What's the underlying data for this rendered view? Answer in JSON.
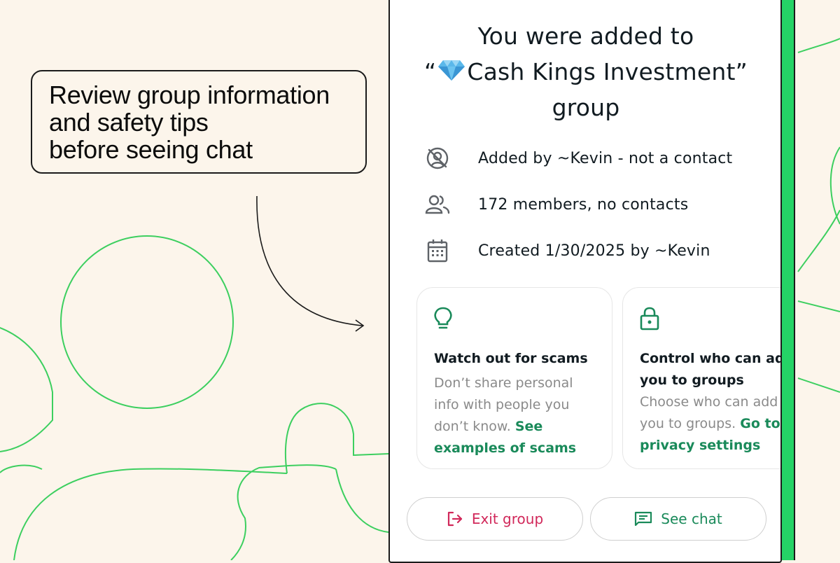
{
  "callout": {
    "lines": [
      "Review group information",
      "and safety tips",
      "before seeing chat"
    ]
  },
  "dialog": {
    "title_line1": "You were added to",
    "title_line2_open": "“",
    "title_emoji": "diamond-emoji",
    "title_line2_name": "Cash Kings Investment”",
    "title_line3": "group",
    "info": [
      {
        "icon": "no-contact-icon",
        "text": "Added by ~Kevin - not a contact"
      },
      {
        "icon": "members-icon",
        "text": "172 members, no contacts"
      },
      {
        "icon": "calendar-icon",
        "text": "Created 1/30/2025 by ~Kevin"
      }
    ],
    "cards": [
      {
        "icon": "lightbulb-icon",
        "title_lines": [
          "Watch out for scams"
        ],
        "body_lines": [
          "Don’t share personal",
          "info with people you"
        ],
        "body_last": "don’t know. ",
        "link_first": "See",
        "link_lines": [
          "examples of scams"
        ]
      },
      {
        "icon": "lock-icon",
        "title_lines": [
          "Control who can add",
          "you to groups"
        ],
        "body_lines": [
          "Choose who can add"
        ],
        "body_last": "you to groups. ",
        "link_first": "Go to",
        "link_lines": [
          "privacy settings"
        ]
      }
    ],
    "buttons": {
      "exit_label": "Exit group",
      "see_chat_label": "See chat"
    }
  },
  "colors": {
    "background": "#fcf5eb",
    "accent_green": "#25d366",
    "link_green": "#1a8a5a",
    "exit_red": "#d1285a"
  }
}
